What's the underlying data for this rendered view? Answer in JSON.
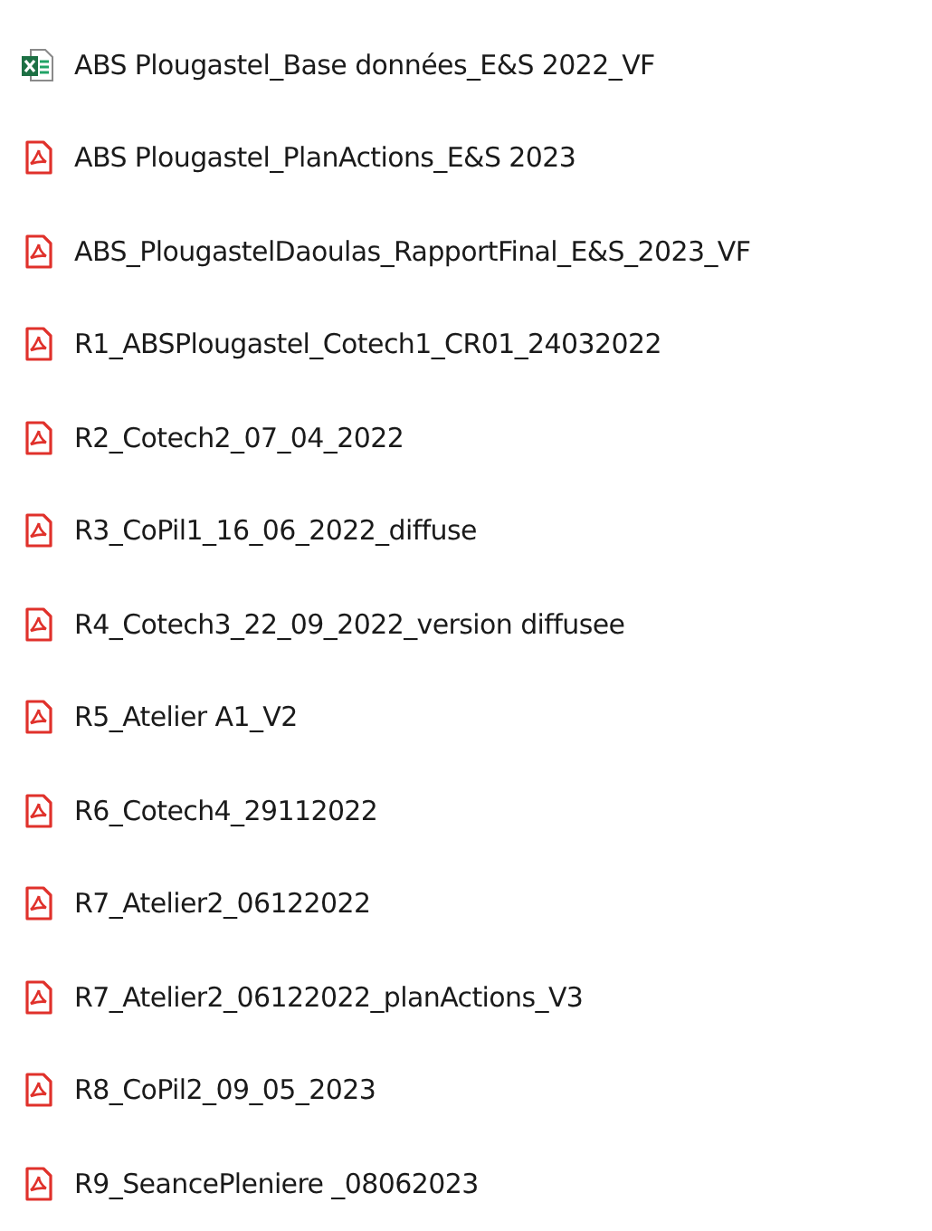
{
  "files": [
    {
      "kind": "excel",
      "name": "ABS Plougastel_Base données_E&S 2022_VF"
    },
    {
      "kind": "pdf",
      "name": "ABS Plougastel_PlanActions_E&S 2023"
    },
    {
      "kind": "pdf",
      "name": "ABS_PlougastelDaoulas_RapportFinal_E&S_2023_VF"
    },
    {
      "kind": "pdf",
      "name": "R1_ABSPlougastel_Cotech1_CR01_24032022"
    },
    {
      "kind": "pdf",
      "name": "R2_Cotech2_07_04_2022"
    },
    {
      "kind": "pdf",
      "name": "R3_CoPil1_16_06_2022_diffuse"
    },
    {
      "kind": "pdf",
      "name": "R4_Cotech3_22_09_2022_version diffusee"
    },
    {
      "kind": "pdf",
      "name": "R5_Atelier A1_V2"
    },
    {
      "kind": "pdf",
      "name": "R6_Cotech4_29112022"
    },
    {
      "kind": "pdf",
      "name": "R7_Atelier2_06122022"
    },
    {
      "kind": "pdf",
      "name": "R7_Atelier2_06122022_planActions_V3"
    },
    {
      "kind": "pdf",
      "name": "R8_CoPil2_09_05_2023"
    },
    {
      "kind": "pdf",
      "name": "R9_SeancePleniere _08062023"
    }
  ]
}
